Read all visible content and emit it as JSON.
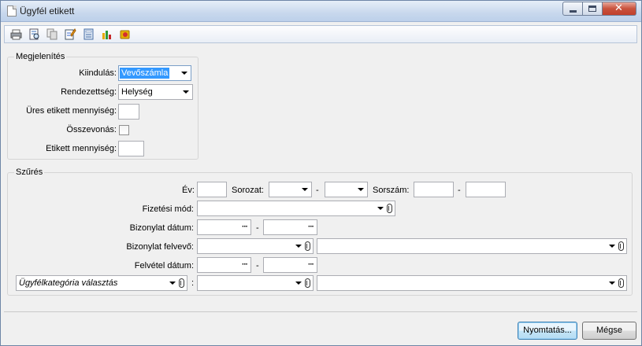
{
  "window": {
    "title": "Ügyfél etikett"
  },
  "colors": {
    "accent": "#3399ff",
    "title_bg": "#c8d8ed"
  },
  "toolbar": {
    "icons": [
      "printer-icon",
      "print-preview-icon",
      "copy-icon",
      "edit-icon",
      "calculator-icon",
      "chart-icon",
      "export-icon"
    ]
  },
  "megjelenites": {
    "title": "Megjelenítés",
    "kiindulas_label": "Kiindulás:",
    "kiindulas_value": "Vevőszámla",
    "rendezettseg_label": "Rendezettség:",
    "rendezettseg_value": "Helység",
    "ures_label": "Üres etikett mennyiség:",
    "osszevonas_label": "Összevonás:",
    "etikett_label": "Etikett mennyiség:"
  },
  "szures": {
    "title": "Szűrés",
    "ev_label": "Év:",
    "sorozat_label": "Sorozat:",
    "sorszam_label": "Sorszám:",
    "dash": "-",
    "fizetesi_mod_label": "Fizetési mód:",
    "bizonylat_datum_label": "Bizonylat dátum:",
    "bizonylat_felvevo_label": "Bizonylat felvevő:",
    "felvetel_datum_label": "Felvétel dátum:",
    "ugyfelkategoria_value": "Ügyfélkategória választás",
    "colon": ":",
    "ellipsis": "···"
  },
  "footer": {
    "print_label": "Nyomtatás...",
    "cancel_label": "Mégse"
  }
}
